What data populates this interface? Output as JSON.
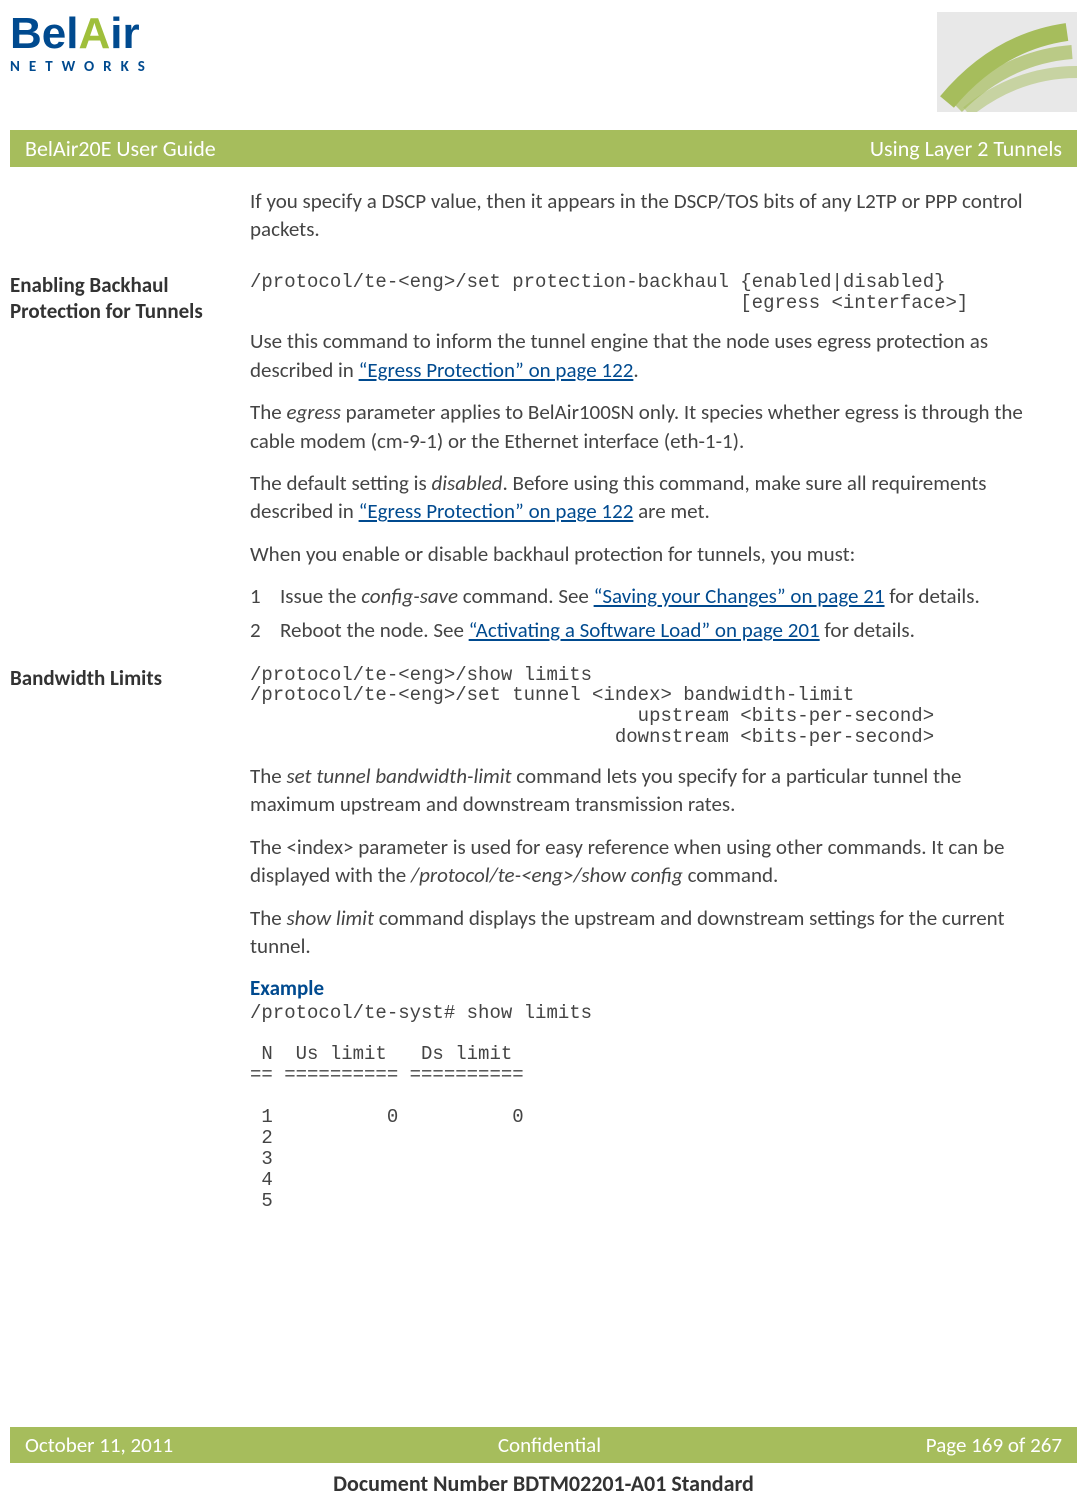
{
  "logo": {
    "text_main": "BelAir",
    "text_sub": "NETWORKS"
  },
  "title_bar": {
    "left": "BelAir20E User Guide",
    "right": "Using Layer 2 Tunnels"
  },
  "intro_para": "If you specify a DSCP value, then it appears in the DSCP/TOS bits of any L2TP or PPP control packets.",
  "section1": {
    "heading": "Enabling Backhaul Protection for Tunnels",
    "code": "/protocol/te-<eng>/set protection-backhaul {enabled|disabled}\n                                           [egress <interface>]",
    "p1_a": "Use this command to inform the tunnel engine that the node uses egress protection as described in ",
    "p1_link": "“Egress Protection” on page 122",
    "p1_b": ".",
    "p2_a": "The ",
    "p2_i": "egress",
    "p2_b": " parameter applies to BelAir100SN only. It species whether egress is through the cable modem (cm-9-1) or the Ethernet interface (eth-1-1).",
    "p3_a": "The default setting is ",
    "p3_i": "disabled",
    "p3_b": ". Before using this command, make sure all requirements described in ",
    "p3_link": "“Egress Protection” on page 122",
    "p3_c": " are met.",
    "p4": "When you enable or disable backhaul protection for tunnels, you must:",
    "li1_a": "Issue the ",
    "li1_i": "config-save",
    "li1_b": " command. See ",
    "li1_link": "“Saving your Changes” on page 21",
    "li1_c": " for details.",
    "li2_a": "Reboot the node. See ",
    "li2_link": "“Activating a Software Load” on page 201",
    "li2_b": " for details."
  },
  "section2": {
    "heading": "Bandwidth Limits",
    "code": "/protocol/te-<eng>/show limits\n/protocol/te-<eng>/set tunnel <index> bandwidth-limit\n                                  upstream <bits-per-second>\n                                downstream <bits-per-second>",
    "p1_a": "The ",
    "p1_i": "set tunnel bandwidth-limit",
    "p1_b": " command lets you specify for a particular tunnel the maximum upstream and downstream transmission rates.",
    "p2_a": "The <index> parameter is used for easy reference when using other commands. It can be displayed with the ",
    "p2_i": "/protocol/te-<eng>/show config",
    "p2_b": " command.",
    "p3_a": "The ",
    "p3_i": "show limit",
    "p3_b": " command displays the upstream and downstream settings for the current tunnel.",
    "example_heading": "Example",
    "example_code": "/protocol/te-syst# show limits\n\n N  Us limit   Ds limit\n== ========== ==========\n\n 1          0          0\n 2\n 3\n 4\n 5"
  },
  "footer": {
    "date": "October 11, 2011",
    "center": "Confidential",
    "page": "Page 169 of 267"
  },
  "doc_number": "Document Number BDTM02201-A01 Standard"
}
